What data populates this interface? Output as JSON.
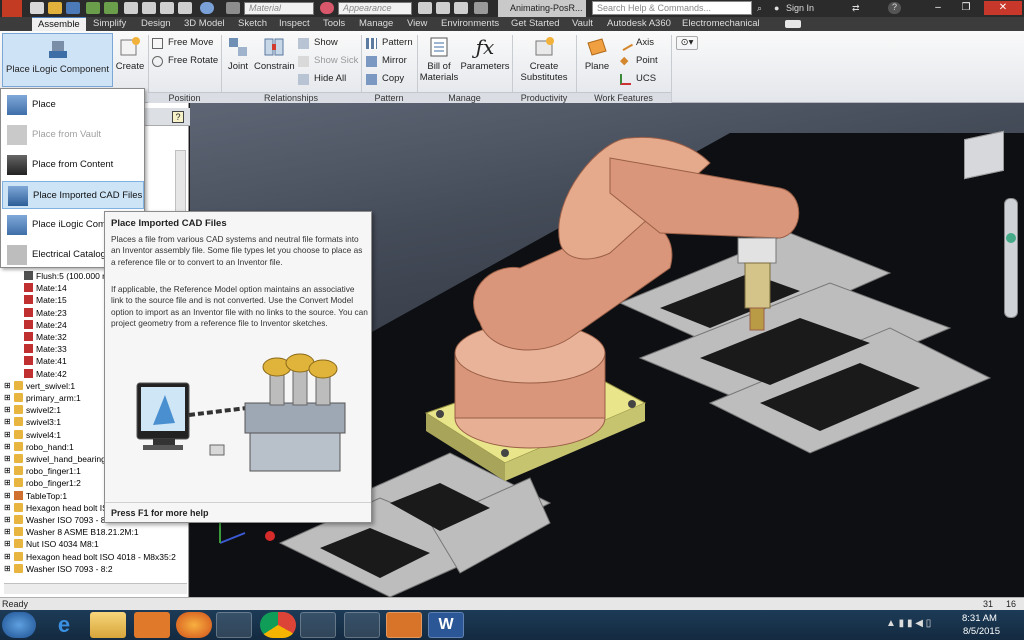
{
  "titlebar": {
    "material_placeholder": "Material",
    "appearance_placeholder": "Appearance",
    "document_tab": "Animating-PosR...",
    "search_placeholder": "Search Help & Commands...",
    "sign_in": "Sign In",
    "help": "?"
  },
  "ribbon_tabs": [
    "Assemble",
    "Simplify",
    "Design",
    "3D Model",
    "Sketch",
    "Inspect",
    "Tools",
    "Manage",
    "View",
    "Environments",
    "Get Started",
    "Vault",
    "Autodesk A360",
    "Electromechanical"
  ],
  "ribbon": {
    "place_ilogic": "Place iLogic Component",
    "create": "Create",
    "free_move": "Free Move",
    "free_rotate": "Free Rotate",
    "joint": "Joint",
    "constrain": "Constrain",
    "show": "Show",
    "show_sick": "Show Sick",
    "hide_all": "Hide All",
    "pattern": "Pattern",
    "mirror": "Mirror",
    "copy": "Copy",
    "bill_of_materials_1": "Bill of",
    "bill_of_materials_2": "Materials",
    "parameters": "Parameters",
    "create_substitutes_1": "Create",
    "create_substitutes_2": "Substitutes",
    "plane": "Plane",
    "axis": "Axis",
    "point": "Point",
    "ucs": "UCS",
    "panels": {
      "position": "Position",
      "relationships": "Relationships",
      "pattern": "Pattern",
      "manage": "Manage",
      "productivity": "Productivity",
      "work_features": "Work Features"
    }
  },
  "dropdown": [
    {
      "label": "Place",
      "state": "normal"
    },
    {
      "label": "Place from Vault",
      "state": "disabled"
    },
    {
      "label": "Place from Content Center",
      "state": "normal"
    },
    {
      "label": "Place Imported CAD Files",
      "state": "highlighted"
    },
    {
      "label": "Place iLogic Comp",
      "state": "normal"
    },
    {
      "label": "Electrical  Catalog",
      "state": "normal"
    }
  ],
  "browser": {
    "help_icon": "?",
    "rows": [
      {
        "label": "Flush:5 (100.000 n",
        "icon": "flush-icon"
      },
      {
        "label": "Mate:14",
        "icon": "mate-icon"
      },
      {
        "label": "Mate:15",
        "icon": "mate-icon"
      },
      {
        "label": "Mate:23",
        "icon": "mate-icon"
      },
      {
        "label": "Mate:24",
        "icon": "mate-icon"
      },
      {
        "label": "Mate:32",
        "icon": "mate-icon"
      },
      {
        "label": "Mate:33",
        "icon": "mate-icon"
      },
      {
        "label": "Mate:41",
        "icon": "mate-icon"
      },
      {
        "label": "Mate:42",
        "icon": "mate-icon"
      },
      {
        "label": "vert_swivel:1",
        "icon": "part-icon"
      },
      {
        "label": "primary_arm:1",
        "icon": "part-icon"
      },
      {
        "label": "swivel2:1",
        "icon": "part-icon"
      },
      {
        "label": "swivel3:1",
        "icon": "part-icon"
      },
      {
        "label": "swivel4:1",
        "icon": "part-icon"
      },
      {
        "label": "robo_hand:1",
        "icon": "part-icon"
      },
      {
        "label": "swivel_hand_bearing:",
        "icon": "part-icon"
      },
      {
        "label": "robo_finger1:1",
        "icon": "part-icon"
      },
      {
        "label": "robo_finger1:2",
        "icon": "part-icon"
      },
      {
        "label": "TableTop:1",
        "icon": "assembly-icon"
      },
      {
        "label": "Hexagon head bolt ISO",
        "icon": "part-icon"
      },
      {
        "label": "Washer ISO 7093 - 8",
        "icon": "part-icon"
      },
      {
        "label": "Washer 8 ASME B18.21.2M:1",
        "icon": "part-icon"
      },
      {
        "label": "Nut ISO 4034 M8:1",
        "icon": "part-icon"
      },
      {
        "label": "Hexagon head bolt ISO 4018 - M8x35:2",
        "icon": "part-icon"
      },
      {
        "label": "Washer ISO 7093 - 8:2",
        "icon": "part-icon"
      }
    ]
  },
  "tooltip": {
    "title": "Place Imported CAD Files",
    "para1": "Places a file from various CAD systems and neutral file formats into an Inventor assembly file. Some file types let you choose to place as a reference file or to convert to an Inventor file.",
    "para2": "If applicable, the Reference Model option maintains an associative link to the source file and is not converted. Use the Convert Model option to import as an Inventor file with no links to the source. You can project geometry from a reference file to Inventor sketches.",
    "footer": "Press F1 for more help"
  },
  "status": {
    "text": "Ready",
    "num1": "31",
    "num2": "16"
  },
  "clock": {
    "time": "8:31 AM",
    "date": "8/5/2015"
  },
  "colors": {
    "accent": "#2f6db5",
    "robot_copper": "#d9967a",
    "base_yellow": "#e2e08a"
  }
}
